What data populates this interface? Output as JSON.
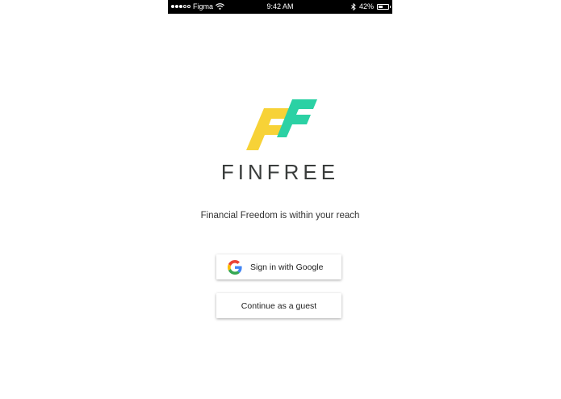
{
  "status_bar": {
    "carrier": "Figma",
    "time": "9:42 AM",
    "battery_percent": "42%",
    "battery_level": 0.42,
    "signal_bars": 3,
    "signal_total": 5
  },
  "brand": {
    "name": "FINFREE",
    "logo_colors": {
      "left": "#f7d237",
      "right": "#2bd1a4"
    }
  },
  "tagline": "Financial Freedom is within your reach",
  "buttons": {
    "google": "Sign in with Google",
    "guest": "Continue as a guest"
  },
  "icons": {
    "signal": "signal-dots-icon",
    "wifi": "wifi-icon",
    "bluetooth": "bluetooth-icon",
    "battery": "battery-icon",
    "google": "google-g-icon"
  }
}
